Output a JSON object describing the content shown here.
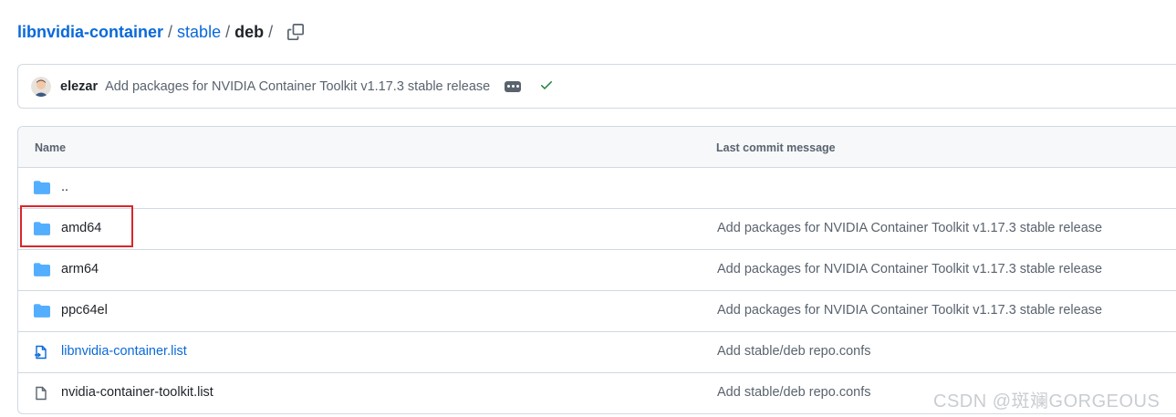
{
  "breadcrumb": {
    "repo": "libnvidia-container",
    "path1": "stable",
    "current": "deb",
    "sep": "/"
  },
  "commit": {
    "author": "elezar",
    "message": "Add packages for NVIDIA Container Toolkit v1.17.3 stable release",
    "status": "success"
  },
  "table": {
    "headers": {
      "name": "Name",
      "message": "Last commit message"
    },
    "rows": [
      {
        "name": "..",
        "icon": "folder-icon",
        "message": ""
      },
      {
        "name": "amd64",
        "icon": "folder-icon",
        "message": "Add packages for NVIDIA Container Toolkit v1.17.3 stable release"
      },
      {
        "name": "arm64",
        "icon": "folder-icon",
        "message": "Add packages for NVIDIA Container Toolkit v1.17.3 stable release"
      },
      {
        "name": "ppc64el",
        "icon": "folder-icon",
        "message": "Add packages for NVIDIA Container Toolkit v1.17.3 stable release"
      },
      {
        "name": "libnvidia-container.list",
        "icon": "symlink-file-icon",
        "message": "Add stable/deb repo.confs"
      },
      {
        "name": "nvidia-container-toolkit.list",
        "icon": "file-icon",
        "message": "Add stable/deb repo.confs"
      }
    ]
  },
  "watermark": "CSDN @斑斓GORGEOUS",
  "colors": {
    "link": "#0969da",
    "folder": "#54aeff",
    "highlight": "#d9262c",
    "success": "#1a7f37"
  }
}
